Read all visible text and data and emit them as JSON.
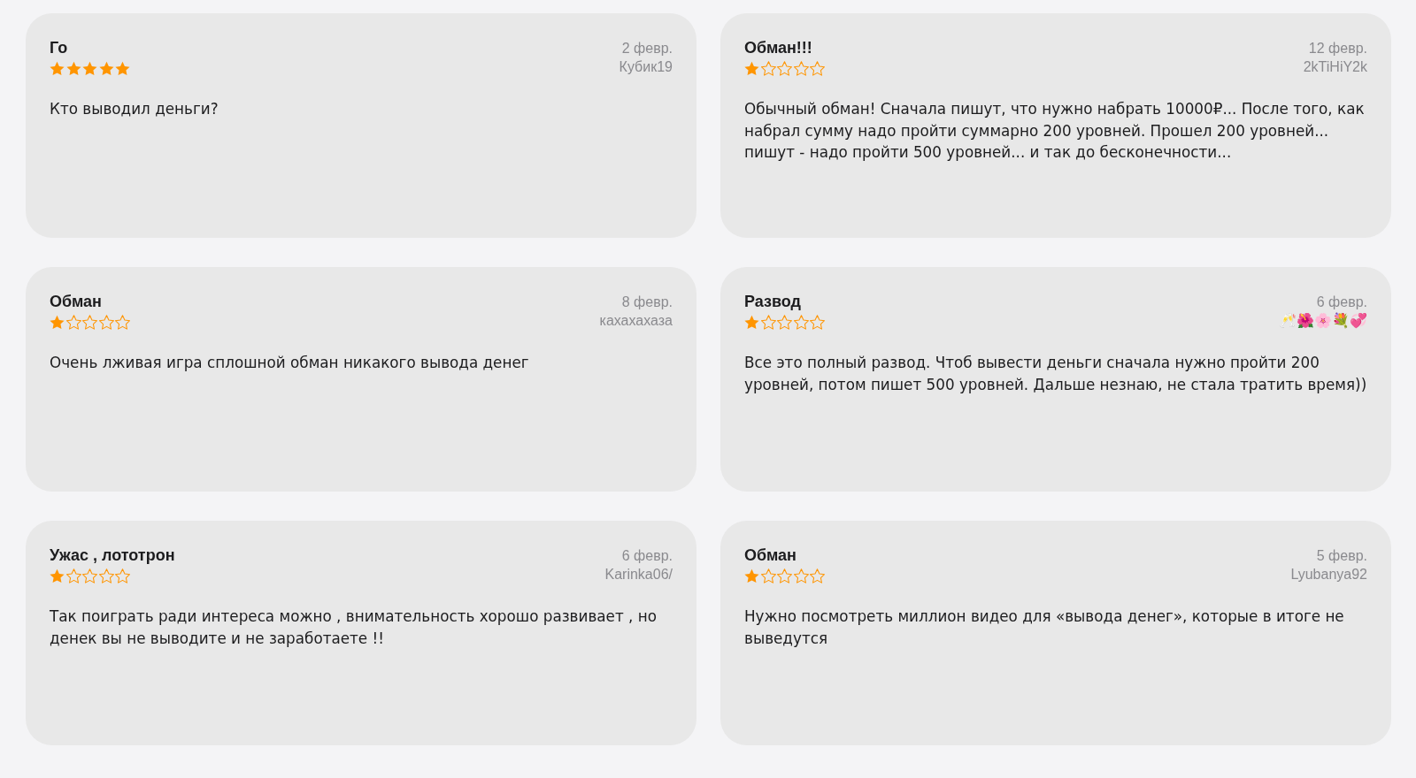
{
  "reviews": [
    {
      "title": "Го",
      "stars": 5,
      "date": "2 февр.",
      "author": "Кубик19",
      "text": "Кто выводил деньги?"
    },
    {
      "title": "Обман!!!",
      "stars": 1,
      "date": "12 февр.",
      "author": "2kTiHiY2k",
      "text": "Обычный обман! Сначала пишут, что нужно набрать 10000₽... После того, как набрал сумму надо пройти суммарно 200 уровней. Прошел 200 уровней... пишут - надо пройти 500 уровней... и так до бесконечности..."
    },
    {
      "title": "Обман",
      "stars": 1,
      "date": "8 февр.",
      "author": "кахахахаза",
      "text": "Очень лживая игра сплошной обман никакого вывода денег"
    },
    {
      "title": "Развод",
      "stars": 1,
      "date": "6 февр.",
      "author": "🥂🌺🌸💐💞",
      "text": "Все это полный развод. Чтоб вывести деньги сначала нужно пройти 200 уровней, потом пишет 500 уровней. Дальше незнаю, не стала тратить время))"
    },
    {
      "title": "Ужас , лототрон",
      "stars": 1,
      "date": "6 февр.",
      "author": "Karinka06/",
      "text": "Так поиграть ради интереса можно , внимательность хорошо развивает , но денек вы не выводите и не заработаете !!"
    },
    {
      "title": "Обман",
      "stars": 1,
      "date": "5 февр.",
      "author": "Lyubanya92",
      "text": "Нужно посмотреть миллион видео для «вывода денег», которые в итоге не выведутся"
    }
  ]
}
